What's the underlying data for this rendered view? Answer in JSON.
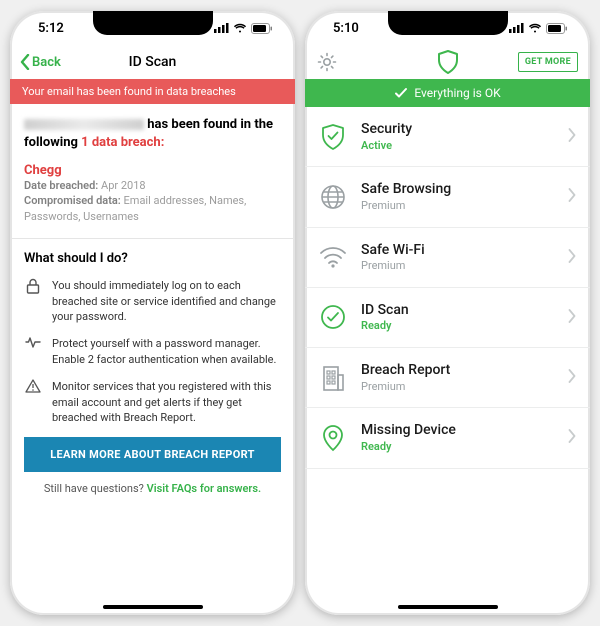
{
  "phoneA": {
    "time": "5:12",
    "back": "Back",
    "title": "ID Scan",
    "alert": "Your email has been found in data breaches",
    "found_suffix": "has been found in the following",
    "count_text": "1 data breach:",
    "breach": {
      "name": "Chegg",
      "date_label": "Date breached:",
      "date_value": "Apr 2018",
      "comp_label": "Compromised data:",
      "comp_value": "Email addresses, Names, Passwords, Usernames"
    },
    "h_what": "What should I do?",
    "advice1": "You should immediately log on to each breached site or service identified and change your password.",
    "advice2": "Protect yourself with a password manager. Enable 2 factor authentication when available.",
    "advice3": "Monitor services that you registered with this email account and get alerts if they get breached with Breach Report.",
    "cta": "LEARN MORE ABOUT BREACH REPORT",
    "faq_q": "Still have questions? ",
    "faq_link": "Visit FAQs for answers."
  },
  "phoneB": {
    "time": "5:10",
    "getmore": "GET MORE",
    "okbar": "Everything is OK",
    "rows": [
      {
        "title": "Security",
        "status": "Active",
        "status_class": "st-active",
        "icon": "shield-check",
        "icon_color": "#3fb74e"
      },
      {
        "title": "Safe Browsing",
        "status": "Premium",
        "status_class": "st-premium",
        "icon": "globe",
        "icon_color": "#9aa0a3"
      },
      {
        "title": "Safe Wi-Fi",
        "status": "Premium",
        "status_class": "st-premium",
        "icon": "wifi",
        "icon_color": "#9aa0a3"
      },
      {
        "title": "ID Scan",
        "status": "Ready",
        "status_class": "st-ready",
        "icon": "circle-check",
        "icon_color": "#3fb74e"
      },
      {
        "title": "Breach Report",
        "status": "Premium",
        "status_class": "st-premium",
        "icon": "building",
        "icon_color": "#9aa0a3"
      },
      {
        "title": "Missing Device",
        "status": "Ready",
        "status_class": "st-ready",
        "icon": "pin",
        "icon_color": "#3fb74e"
      }
    ]
  }
}
